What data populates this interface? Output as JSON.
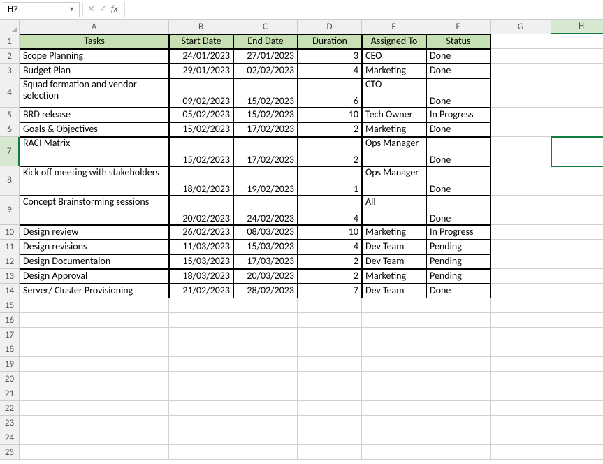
{
  "formula_bar": {
    "name_box": "H7",
    "cancel": "✕",
    "accept": "✓",
    "fx": "fx",
    "formula": ""
  },
  "cols": [
    "A",
    "B",
    "C",
    "D",
    "E",
    "F",
    "G",
    "H"
  ],
  "selected_col": "H",
  "selected_row": 7,
  "headers": {
    "a": "Tasks",
    "b": "Start Date",
    "c": "End Date",
    "d": "Duration",
    "e": "Assigned To",
    "f": "Status"
  },
  "rows": [
    {
      "n": 2,
      "task": "Scope Planning",
      "start": "24/01/2023",
      "end": "27/01/2023",
      "dur": "3",
      "who": "CEO",
      "status": "Done",
      "h": 1
    },
    {
      "n": 3,
      "task": "Budget Plan",
      "start": "29/01/2023",
      "end": "02/02/2023",
      "dur": "4",
      "who": "Marketing",
      "status": "Done",
      "h": 1
    },
    {
      "n": 4,
      "task": "Squad formation and vendor selection",
      "start": "09/02/2023",
      "end": "15/02/2023",
      "dur": "6",
      "who": "CTO",
      "status": "Done",
      "h": 2
    },
    {
      "n": 5,
      "task": "BRD release",
      "start": "05/02/2023",
      "end": "15/02/2023",
      "dur": "10",
      "who": "Tech Owner",
      "status": "In Progress",
      "h": 1
    },
    {
      "n": 6,
      "task": "Goals & Objectives",
      "start": "15/02/2023",
      "end": "17/02/2023",
      "dur": "2",
      "who": "Marketing",
      "status": "Done",
      "h": 1
    },
    {
      "n": 7,
      "task": "RACI Matrix",
      "start": "15/02/2023",
      "end": "17/02/2023",
      "dur": "2",
      "who": "Ops Manager",
      "status": "Done",
      "h": 2
    },
    {
      "n": 8,
      "task": "Kick off meeting with stakeholders",
      "start": "18/02/2023",
      "end": "19/02/2023",
      "dur": "1",
      "who": "Ops Manager",
      "status": "Done",
      "h": 2
    },
    {
      "n": 9,
      "task": "Concept Brainstorming sessions",
      "start": "20/02/2023",
      "end": "24/02/2023",
      "dur": "4",
      "who": "All",
      "status": "Done",
      "h": 2
    },
    {
      "n": 10,
      "task": "Design review",
      "start": "26/02/2023",
      "end": "08/03/2023",
      "dur": "10",
      "who": "Marketing",
      "status": "In Progress",
      "h": 1
    },
    {
      "n": 11,
      "task": "Design revisions",
      "start": "11/03/2023",
      "end": "15/03/2023",
      "dur": "4",
      "who": "Dev Team",
      "status": "Pending",
      "h": 1
    },
    {
      "n": 12,
      "task": "Design Documentaion",
      "start": "15/03/2023",
      "end": "17/03/2023",
      "dur": "2",
      "who": "Dev Team",
      "status": "Pending",
      "h": 1
    },
    {
      "n": 13,
      "task": "Design Approval",
      "start": "18/03/2023",
      "end": "20/03/2023",
      "dur": "2",
      "who": "Marketing",
      "status": "Pending",
      "h": 1
    },
    {
      "n": 14,
      "task": "Server/ Cluster Provisioning",
      "start": "21/02/2023",
      "end": "28/02/2023",
      "dur": "7",
      "who": "Dev Team",
      "status": "Done",
      "h": 1
    }
  ],
  "empty_rows": [
    15,
    16,
    17,
    18,
    19,
    20,
    21,
    22,
    23,
    24,
    25
  ],
  "chart_data": {
    "type": "table",
    "title": "",
    "columns": [
      "Tasks",
      "Start Date",
      "End Date",
      "Duration",
      "Assigned To",
      "Status"
    ],
    "rows": [
      [
        "Scope Planning",
        "24/01/2023",
        "27/01/2023",
        3,
        "CEO",
        "Done"
      ],
      [
        "Budget Plan",
        "29/01/2023",
        "02/02/2023",
        4,
        "Marketing",
        "Done"
      ],
      [
        "Squad formation and vendor selection",
        "09/02/2023",
        "15/02/2023",
        6,
        "CTO",
        "Done"
      ],
      [
        "BRD release",
        "05/02/2023",
        "15/02/2023",
        10,
        "Tech Owner",
        "In Progress"
      ],
      [
        "Goals & Objectives",
        "15/02/2023",
        "17/02/2023",
        2,
        "Marketing",
        "Done"
      ],
      [
        "RACI Matrix",
        "15/02/2023",
        "17/02/2023",
        2,
        "Ops Manager",
        "Done"
      ],
      [
        "Kick off meeting with stakeholders",
        "18/02/2023",
        "19/02/2023",
        1,
        "Ops Manager",
        "Done"
      ],
      [
        "Concept Brainstorming sessions",
        "20/02/2023",
        "24/02/2023",
        4,
        "All",
        "Done"
      ],
      [
        "Design review",
        "26/02/2023",
        "08/03/2023",
        10,
        "Marketing",
        "In Progress"
      ],
      [
        "Design revisions",
        "11/03/2023",
        "15/03/2023",
        4,
        "Dev Team",
        "Pending"
      ],
      [
        "Design Documentaion",
        "15/03/2023",
        "17/03/2023",
        2,
        "Dev Team",
        "Pending"
      ],
      [
        "Design Approval",
        "18/03/2023",
        "20/03/2023",
        2,
        "Marketing",
        "Pending"
      ],
      [
        "Server/ Cluster Provisioning",
        "21/02/2023",
        "28/02/2023",
        7,
        "Dev Team",
        "Done"
      ]
    ]
  }
}
